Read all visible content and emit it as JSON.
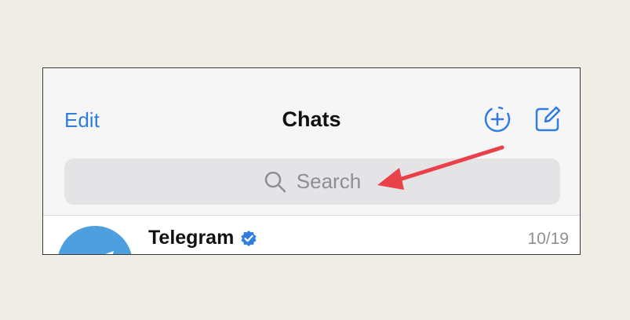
{
  "header": {
    "edit_label": "Edit",
    "title": "Chats",
    "new_story_icon": "add-story-icon",
    "compose_icon": "compose-icon"
  },
  "search": {
    "placeholder": "Search",
    "icon": "search-icon"
  },
  "chats": [
    {
      "name": "Telegram",
      "verified": true,
      "date": "10/19"
    }
  ],
  "colors": {
    "accent": "#2f7de1",
    "annotation_arrow": "#e84149",
    "avatar": "#4d9fe0"
  }
}
